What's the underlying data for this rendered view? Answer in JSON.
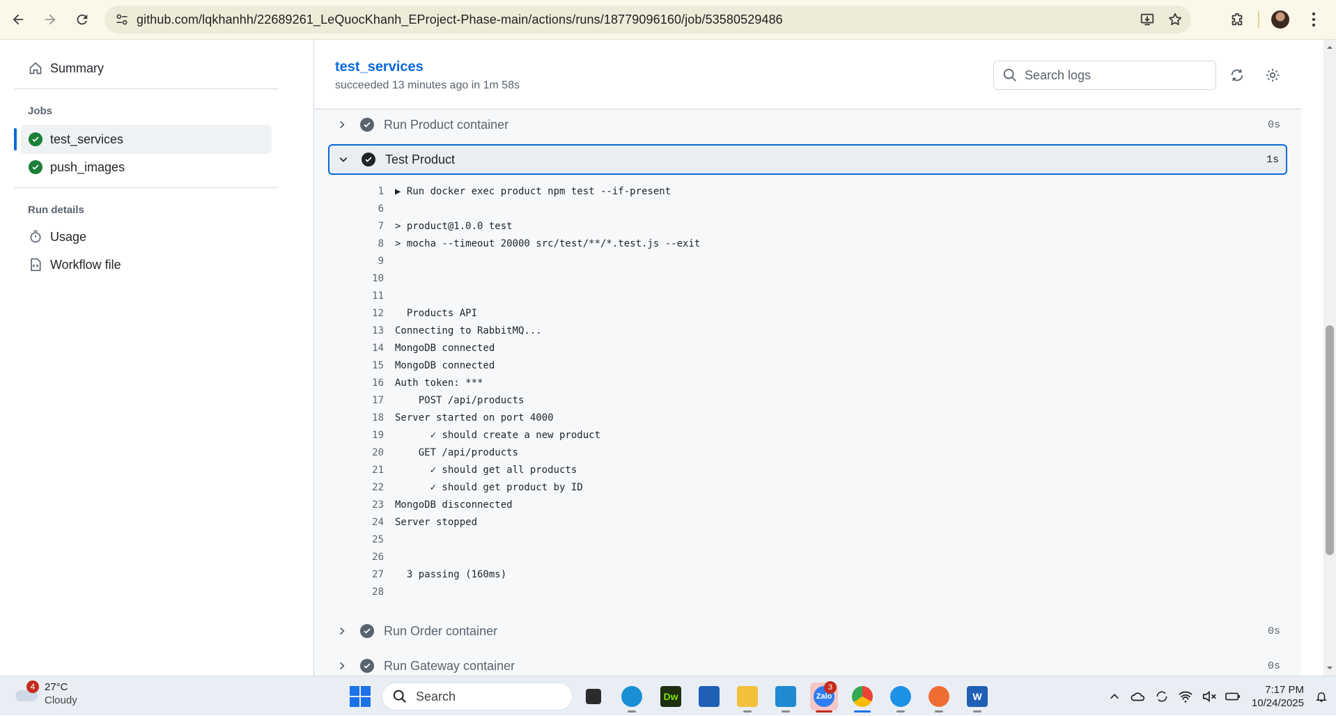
{
  "browser": {
    "url": "github.com/lqkhanhh/22689261_LeQuocKhanh_EProject-Phase-main/actions/runs/18779096160/job/53580529486"
  },
  "sidebar": {
    "summary_label": "Summary",
    "jobs_heading": "Jobs",
    "jobs": [
      {
        "label": "test_services",
        "status": "success",
        "active": true
      },
      {
        "label": "push_images",
        "status": "success",
        "active": false
      }
    ],
    "run_details_heading": "Run details",
    "usage_label": "Usage",
    "workflow_file_label": "Workflow file"
  },
  "job": {
    "title": "test_services",
    "subtitle": "succeeded 13 minutes ago in 1m 58s",
    "search_placeholder": "Search logs"
  },
  "steps": {
    "before": {
      "name": "Run Product container",
      "duration": "0s"
    },
    "expanded": {
      "name": "Test Product",
      "duration": "1s"
    },
    "after": [
      {
        "name": "Run Order container",
        "duration": "0s"
      },
      {
        "name": "Run Gateway container",
        "duration": "0s"
      }
    ]
  },
  "log_lines": [
    {
      "n": "1",
      "t": "▶ Run docker exec product npm test --if-present"
    },
    {
      "n": "6",
      "t": ""
    },
    {
      "n": "7",
      "t": "> product@1.0.0 test"
    },
    {
      "n": "8",
      "t": "> mocha --timeout 20000 src/test/**/*.test.js --exit"
    },
    {
      "n": "9",
      "t": ""
    },
    {
      "n": "10",
      "t": ""
    },
    {
      "n": "11",
      "t": ""
    },
    {
      "n": "12",
      "t": "  Products API"
    },
    {
      "n": "13",
      "t": "Connecting to RabbitMQ..."
    },
    {
      "n": "14",
      "t": "MongoDB connected"
    },
    {
      "n": "15",
      "t": "MongoDB connected"
    },
    {
      "n": "16",
      "t": "Auth token: ***"
    },
    {
      "n": "17",
      "t": "    POST /api/products"
    },
    {
      "n": "18",
      "t": "Server started on port 4000"
    },
    {
      "n": "19",
      "t": "      ✓ should create a new product"
    },
    {
      "n": "20",
      "t": "    GET /api/products"
    },
    {
      "n": "21",
      "t": "      ✓ should get all products"
    },
    {
      "n": "22",
      "t": "      ✓ should get product by ID"
    },
    {
      "n": "23",
      "t": "MongoDB disconnected"
    },
    {
      "n": "24",
      "t": "Server stopped"
    },
    {
      "n": "25",
      "t": ""
    },
    {
      "n": "26",
      "t": ""
    },
    {
      "n": "27",
      "t": "  3 passing (160ms)"
    },
    {
      "n": "28",
      "t": ""
    }
  ],
  "taskbar": {
    "weather_temp": "27°C",
    "weather_cond": "Cloudy",
    "weather_badge": "4",
    "search_label": "Search",
    "zalo_badge": "3",
    "time": "7:17 PM",
    "date": "10/24/2025"
  },
  "colors": {
    "accent": "#0969da",
    "success": "#1a7f37",
    "chrome_bg": "#fbf8e9"
  }
}
